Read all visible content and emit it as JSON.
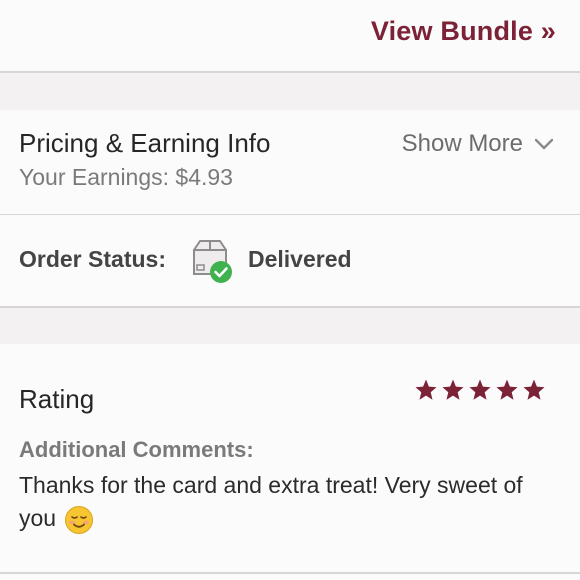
{
  "bundle": {
    "link_label": "View Bundle »"
  },
  "pricing": {
    "title": "Pricing & Earning Info",
    "earnings": "Your Earnings: $4.93",
    "toggle_label": "Show More"
  },
  "order": {
    "label": "Order Status:",
    "status": "Delivered",
    "icon": "box-delivered-icon",
    "status_color": "#3fb24f"
  },
  "rating": {
    "title": "Rating",
    "stars": 5,
    "max_stars": 5,
    "star_color": "#7b2236",
    "comments_label": "Additional Comments:",
    "comment_text": "Thanks for the card and extra treat! Very sweet of you",
    "emoji": "smiling-face-icon"
  },
  "colors": {
    "accent": "#7b2236",
    "divider": "#d7d5d6",
    "section_gap": "#f3f1f2"
  }
}
